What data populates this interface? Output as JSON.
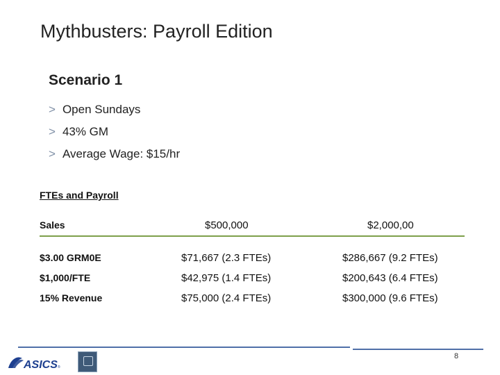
{
  "slide": {
    "title": "Mythbusters: Payroll Edition",
    "page_number": "8"
  },
  "scenario": {
    "heading": "Scenario 1",
    "bullet_marker": ">",
    "bullets": [
      "Open Sundays",
      "43% GM",
      "Average Wage: $15/hr"
    ]
  },
  "table": {
    "section_label": "FTEs and Payroll",
    "header": [
      "Sales",
      "$500,000",
      "$2,000,00"
    ],
    "rows": [
      [
        "$3.00 GRM0E",
        "$71,667 (2.3 FTEs)",
        "$286,667 (9.2 FTEs)"
      ],
      [
        "$1,000/FTE",
        "$42,975 (1.4 FTEs)",
        "$200,643 (6.4 FTEs)"
      ],
      [
        "15% Revenue",
        "$75,000 (2.4 FTEs)",
        "$300,000 (9.6 FTEs)"
      ]
    ]
  },
  "footer": {
    "logo_text": "ASICS",
    "logo_color": "#1d3f8f",
    "line_color": "#4f6fa8",
    "divider_color": "#7d9f4a"
  }
}
